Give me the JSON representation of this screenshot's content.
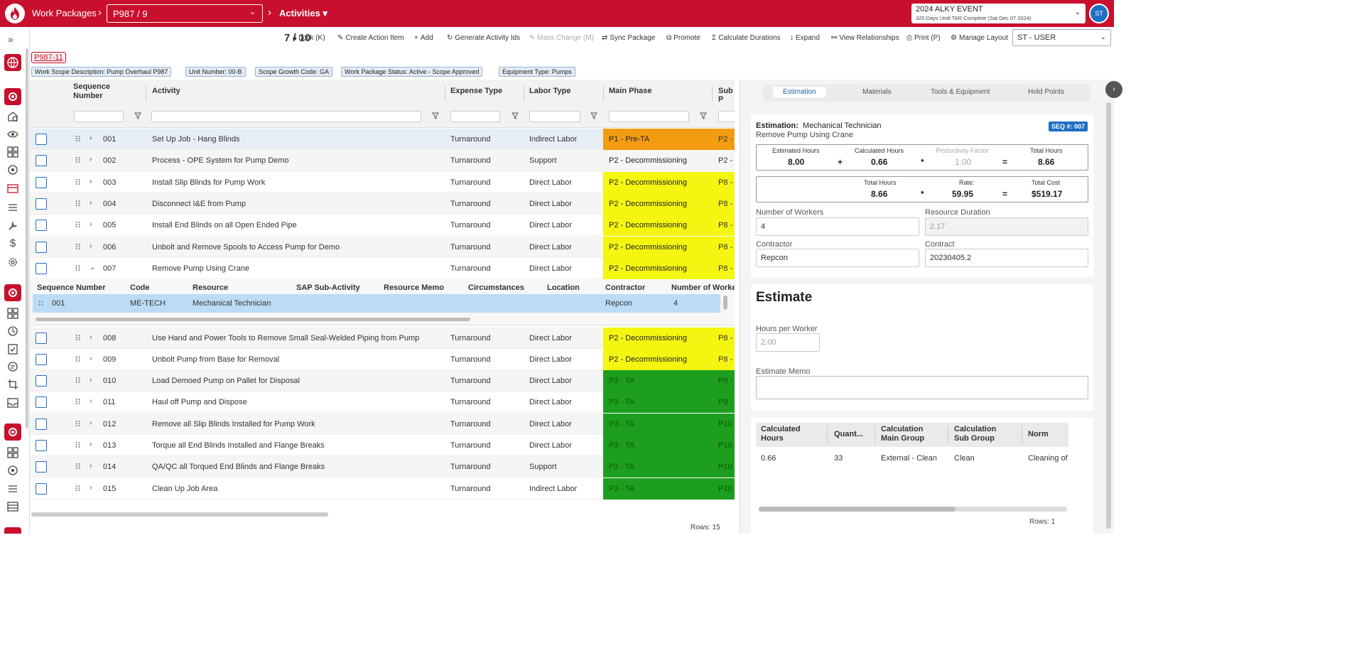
{
  "header": {
    "app_title": "Work Packages",
    "package_select": "P987 / 9",
    "activities_label": "Activities",
    "event": {
      "title": "2024 ALKY EVENT",
      "subtitle": "320 Days Until TAR Complete (Sat Dec 07 2024)"
    },
    "user_initials": "ST"
  },
  "toolbar": {
    "counter": "7 / 10",
    "buttons": [
      {
        "label": "Lock (K)",
        "icon": "lock-icon"
      },
      {
        "label": "Create Action Item",
        "icon": "pencil-icon"
      },
      {
        "label": "Add",
        "icon": "plus-icon"
      },
      {
        "label": "Generate Activity Ids",
        "icon": "refresh-icon"
      },
      {
        "label": "Mass Change (M)",
        "icon": "pencil-icon",
        "disabled": true
      },
      {
        "label": "Sync Package",
        "icon": "sync-icon"
      },
      {
        "label": "Promote",
        "icon": "promote-icon"
      },
      {
        "label": "Calculate Durations",
        "icon": "sigma-icon"
      },
      {
        "label": "Expand",
        "icon": "expand-icon"
      },
      {
        "label": "View Relationships",
        "icon": "relationships-icon"
      },
      {
        "label": "Print (P)",
        "icon": "print-icon"
      },
      {
        "label": "Manage Layout",
        "icon": "gear-icon"
      }
    ],
    "role_select": "ST - USER"
  },
  "package": {
    "id": "P987-11",
    "tags": [
      "Work Scope Description: Pump Overhaul P987",
      "Unit Number: 00-B",
      "Scope Growth Code: GA",
      "Work Package Status: Active - Scope Approved",
      "Equipment Type: Pumps"
    ]
  },
  "grid": {
    "columns": [
      "Sequence Number",
      "Activity",
      "Expense Type",
      "Labor Type",
      "Main Phase",
      "Sub P"
    ],
    "rows": [
      {
        "seq": "001",
        "activity": "Set Up Job - Hang Blinds",
        "expense": "Turnaround",
        "labor": "Indirect Labor",
        "phase": "P1 - Pre-TA",
        "sub": "P2 -",
        "phase_color": "#f39c12"
      },
      {
        "seq": "002",
        "activity": "Process - OPE System for Pump Demo",
        "expense": "Turnaround",
        "labor": "Support",
        "phase": "P2 - Decommissioning",
        "sub": "P2 -",
        "phase_color": ""
      },
      {
        "seq": "003",
        "activity": "Install Slip Blinds for Pump Work",
        "expense": "Turnaround",
        "labor": "Direct Labor",
        "phase": "P2 - Decommissioning",
        "sub": "P8 -",
        "phase_color": "#f5f512"
      },
      {
        "seq": "004",
        "activity": "Disconnect I&E from Pump",
        "expense": "Turnaround",
        "labor": "Direct Labor",
        "phase": "P2 - Decommissioning",
        "sub": "P8 -",
        "phase_color": "#f5f512"
      },
      {
        "seq": "005",
        "activity": "Install End Blinds on all Open Ended Pipe",
        "expense": "Turnaround",
        "labor": "Direct Labor",
        "phase": "P2 - Decommissioning",
        "sub": "P8 -",
        "phase_color": "#f5f512"
      },
      {
        "seq": "006",
        "activity": "Unbolt and Remove Spools to Access Pump for Demo",
        "expense": "Turnaround",
        "labor": "Direct Labor",
        "phase": "P2 - Decommissioning",
        "sub": "P8 -",
        "phase_color": "#f5f512"
      },
      {
        "seq": "007",
        "activity": "Remove Pump Using Crane",
        "expense": "Turnaround",
        "labor": "Direct Labor",
        "phase": "P2 - Decommissioning",
        "sub": "P8 -",
        "phase_color": "#f5f512"
      },
      {
        "seq": "008",
        "activity": "Use Hand and Power Tools to Remove Small Seal-Welded Piping from Pump",
        "expense": "Turnaround",
        "labor": "Direct Labor",
        "phase": "P2 - Decommissioning",
        "sub": "P8 -",
        "phase_color": "#f5f512"
      },
      {
        "seq": "009",
        "activity": "Unbolt Pump from Base for Removal",
        "expense": "Turnaround",
        "labor": "Direct Labor",
        "phase": "P2 - Decommissioning",
        "sub": "P8 -",
        "phase_color": "#f5f512"
      },
      {
        "seq": "010",
        "activity": "Load Demoed Pump on Pallet for Disposal",
        "expense": "Turnaround",
        "labor": "Direct Labor",
        "phase": "P3 - TA",
        "sub": "P9 -",
        "phase_color": "#1e9e1e"
      },
      {
        "seq": "011",
        "activity": "Haul off Pump and Dispose",
        "expense": "Turnaround",
        "labor": "Direct Labor",
        "phase": "P3 - TA",
        "sub": "P9 -",
        "phase_color": "#1e9e1e"
      },
      {
        "seq": "012",
        "activity": "Remove all Slip Blinds Installed for Pump Work",
        "expense": "Turnaround",
        "labor": "Direct Labor",
        "phase": "P3 - TA",
        "sub": "P10",
        "phase_color": "#1e9e1e"
      },
      {
        "seq": "013",
        "activity": "Torque all End Blinds Installed and Flange Breaks",
        "expense": "Turnaround",
        "labor": "Direct Labor",
        "phase": "P3 - TA",
        "sub": "P10",
        "phase_color": "#1e9e1e"
      },
      {
        "seq": "014",
        "activity": "QA/QC all Torqued End Blinds and Flange Breaks",
        "expense": "Turnaround",
        "labor": "Support",
        "phase": "P3 - TA",
        "sub": "P10",
        "phase_color": "#1e9e1e"
      },
      {
        "seq": "015",
        "activity": "Clean Up Job Area",
        "expense": "Turnaround",
        "labor": "Indirect Labor",
        "phase": "P3 - TA",
        "sub": "P10",
        "phase_color": "#1e9e1e"
      }
    ],
    "rows_count": "Rows: 15",
    "detail": {
      "columns": [
        "Sequence Number",
        "Code",
        "Resource",
        "SAP Sub-Activity",
        "Resource Memo",
        "Circumstances",
        "Location",
        "Contractor",
        "Number of Worke"
      ],
      "row": {
        "seq": "001",
        "code": "ME-TECH",
        "resource": "Mechanical Technician",
        "contractor": "Repcon",
        "workers": "4"
      }
    }
  },
  "panel": {
    "tabs": [
      "Estimation",
      "Materials",
      "Tools & Equipment",
      "Hold Points"
    ],
    "estimation": {
      "label": "Estimation:",
      "craft": "Mechanical Technician",
      "activity": "Remove Pump Using Crane",
      "seq_badge": "SEQ #: 007",
      "calc1": {
        "estimated_hours_label": "Estimated Hours",
        "estimated_hours": "8.00",
        "calculated_hours_label": "Calculated Hours",
        "calculated_hours": "0.66",
        "productivity_label": "Productivity Factor",
        "productivity": "1.00",
        "total_hours_label": "Total Hours",
        "total_hours": "8.66"
      },
      "calc2": {
        "total_hours_label": "Total Hours",
        "total_hours": "8.66",
        "rate_label": "Rate:",
        "rate": "59.95",
        "total_cost_label": "Total Cost",
        "total_cost": "$519.17"
      },
      "ops": {
        "plus": "+",
        "times": "*",
        "equals": "="
      },
      "workers_label": "Number of Workers",
      "workers": "4",
      "duration_label": "Resource Duration",
      "duration": "2.17",
      "contractor_label": "Contractor",
      "contractor": "Repcon",
      "contract_label": "Contract",
      "contract": "20230405.2"
    },
    "estimate": {
      "title": "Estimate",
      "hours_per_worker_label": "Hours per Worker",
      "hours_per_worker_placeholder": "2.00",
      "memo_label": "Estimate Memo"
    },
    "calc_table": {
      "columns": [
        "Calculated\nHours",
        "Quant...",
        "Calculation\nMain Group",
        "Calculation\nSub Group",
        "Norm"
      ],
      "row": [
        "0.66",
        "33",
        "External - Clean",
        "Clean",
        "Cleaning of"
      ],
      "rows_count": "Rows: 1"
    }
  }
}
